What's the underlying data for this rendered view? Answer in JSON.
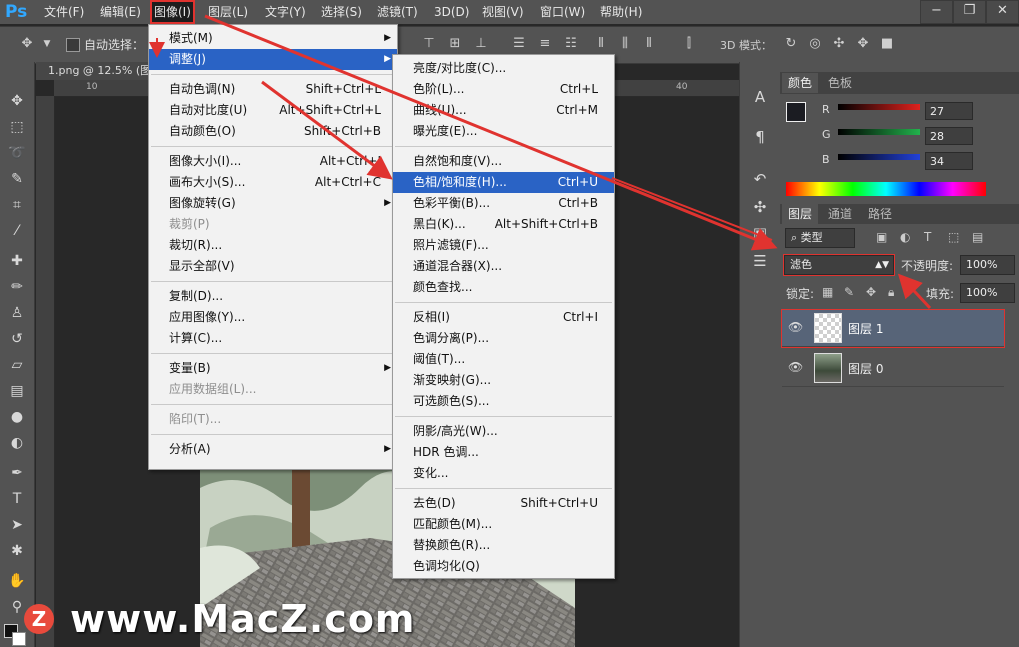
{
  "app": {
    "logo": "Ps"
  },
  "menubar": {
    "items": [
      "文件(F)",
      "编辑(E)",
      "图像(I)",
      "图层(L)",
      "文字(Y)",
      "选择(S)",
      "滤镜(T)",
      "3D(D)",
      "视图(V)",
      "窗口(W)",
      "帮助(H)"
    ],
    "active": "图像(I)"
  },
  "window_controls": {
    "minimize": "−",
    "restore": "❐",
    "close": "✕"
  },
  "options_bar": {
    "auto_select_label": "自动选择：",
    "mode_3d_label": "3D 模式："
  },
  "document": {
    "tab_title": "1.png @ 12.5% (图",
    "ruler_numbers": [
      "10",
      "40"
    ]
  },
  "image_menu": {
    "items": [
      {
        "label": "模式(M)",
        "shortcut": "",
        "submenu": true,
        "disabled": false
      },
      {
        "label": "调整(J)",
        "shortcut": "",
        "submenu": true,
        "disabled": false,
        "highlighted": true
      },
      {
        "label": "自动色调(N)",
        "shortcut": "Shift+Ctrl+L"
      },
      {
        "label": "自动对比度(U)",
        "shortcut": "Alt+Shift+Ctrl+L"
      },
      {
        "label": "自动颜色(O)",
        "shortcut": "Shift+Ctrl+B"
      },
      {
        "label": "图像大小(I)...",
        "shortcut": "Alt+Ctrl+I"
      },
      {
        "label": "画布大小(S)...",
        "shortcut": "Alt+Ctrl+C"
      },
      {
        "label": "图像旋转(G)",
        "shortcut": "",
        "submenu": true
      },
      {
        "label": "裁剪(P)",
        "shortcut": "",
        "disabled": true
      },
      {
        "label": "裁切(R)...",
        "shortcut": ""
      },
      {
        "label": "显示全部(V)",
        "shortcut": ""
      },
      {
        "label": "复制(D)...",
        "shortcut": ""
      },
      {
        "label": "应用图像(Y)...",
        "shortcut": ""
      },
      {
        "label": "计算(C)...",
        "shortcut": ""
      },
      {
        "label": "变量(B)",
        "shortcut": "",
        "submenu": true
      },
      {
        "label": "应用数据组(L)...",
        "shortcut": "",
        "disabled": true
      },
      {
        "label": "陷印(T)...",
        "shortcut": "",
        "disabled": true
      },
      {
        "label": "分析(A)",
        "shortcut": "",
        "submenu": true
      }
    ]
  },
  "adjust_menu": {
    "items": [
      {
        "label": "亮度/对比度(C)...",
        "shortcut": ""
      },
      {
        "label": "色阶(L)...",
        "shortcut": "Ctrl+L"
      },
      {
        "label": "曲线(U)...",
        "shortcut": "Ctrl+M"
      },
      {
        "label": "曝光度(E)...",
        "shortcut": ""
      },
      {
        "label": "自然饱和度(V)...",
        "shortcut": ""
      },
      {
        "label": "色相/饱和度(H)...",
        "shortcut": "Ctrl+U",
        "highlighted": true
      },
      {
        "label": "色彩平衡(B)...",
        "shortcut": "Ctrl+B"
      },
      {
        "label": "黑白(K)...",
        "shortcut": "Alt+Shift+Ctrl+B"
      },
      {
        "label": "照片滤镜(F)...",
        "shortcut": ""
      },
      {
        "label": "通道混合器(X)...",
        "shortcut": ""
      },
      {
        "label": "颜色查找...",
        "shortcut": ""
      },
      {
        "label": "反相(I)",
        "shortcut": "Ctrl+I"
      },
      {
        "label": "色调分离(P)...",
        "shortcut": ""
      },
      {
        "label": "阈值(T)...",
        "shortcut": ""
      },
      {
        "label": "渐变映射(G)...",
        "shortcut": ""
      },
      {
        "label": "可选颜色(S)...",
        "shortcut": ""
      },
      {
        "label": "阴影/高光(W)...",
        "shortcut": ""
      },
      {
        "label": "HDR 色调...",
        "shortcut": ""
      },
      {
        "label": "变化...",
        "shortcut": ""
      },
      {
        "label": "去色(D)",
        "shortcut": "Shift+Ctrl+U"
      },
      {
        "label": "匹配颜色(M)...",
        "shortcut": ""
      },
      {
        "label": "替换颜色(R)...",
        "shortcut": ""
      },
      {
        "label": "色调均化(Q)",
        "shortcut": ""
      }
    ]
  },
  "color_panel": {
    "tabs": [
      "颜色",
      "色板"
    ],
    "channels": [
      {
        "label": "R",
        "value": "27",
        "color": "#e0221e"
      },
      {
        "label": "G",
        "value": "28",
        "color": "#22b24c"
      },
      {
        "label": "B",
        "value": "34",
        "color": "#2241d8"
      }
    ]
  },
  "layers_panel": {
    "tabs": [
      "图层",
      "通道",
      "路径"
    ],
    "filter_label": "类型",
    "blend_mode": "滤色",
    "opacity_label": "不透明度:",
    "opacity_value": "100%",
    "lock_label": "锁定:",
    "fill_label": "填充:",
    "fill_value": "100%",
    "layers": [
      {
        "name": "图层 1",
        "selected": true
      },
      {
        "name": "图层 0",
        "selected": false
      }
    ]
  },
  "watermark": {
    "logo_letter": "Z",
    "text": "www.MacZ.com"
  },
  "annotation_color": "#e0332f"
}
